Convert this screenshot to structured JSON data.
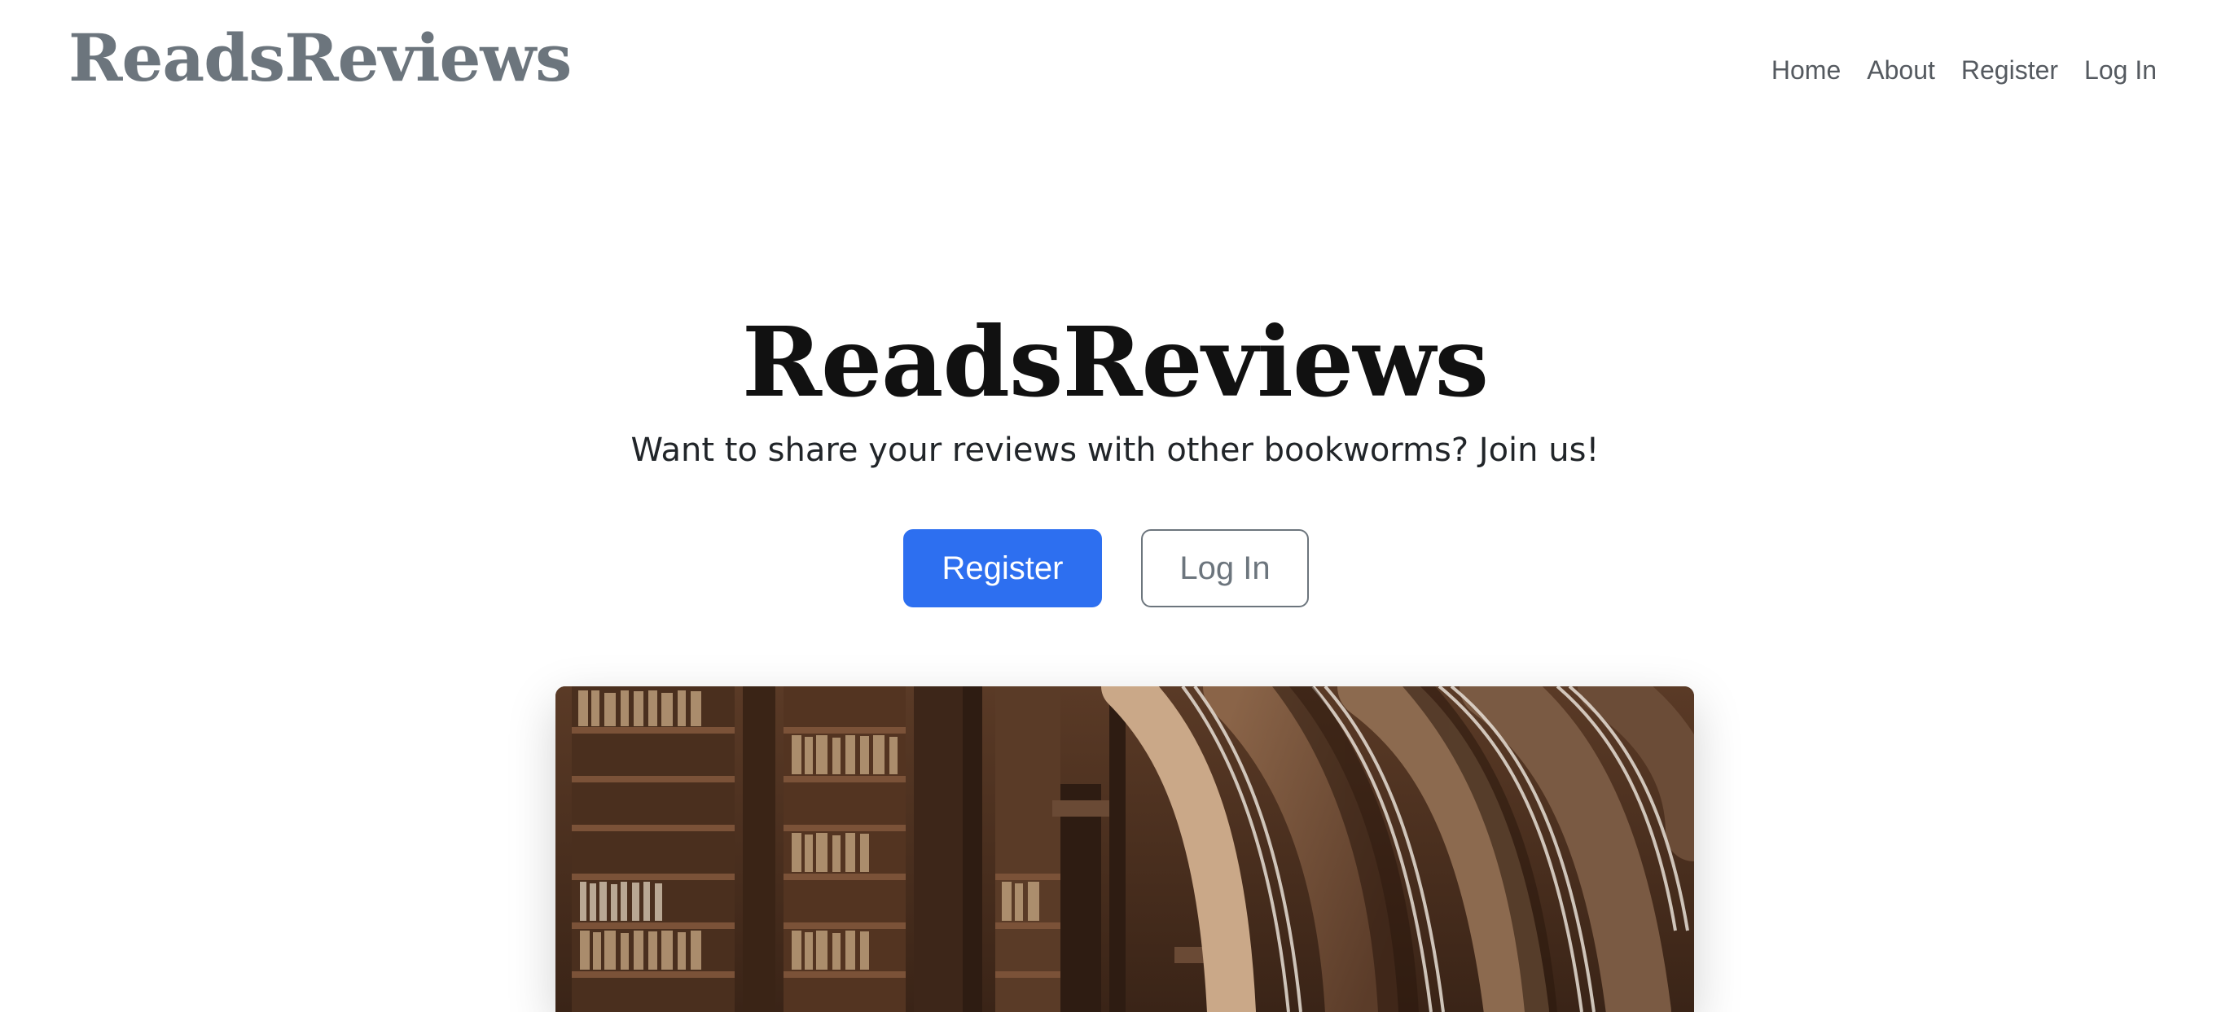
{
  "header": {
    "brand": "ReadsReviews",
    "nav": [
      "Home",
      "About",
      "Register",
      "Log In"
    ]
  },
  "hero": {
    "title": "ReadsReviews",
    "subtitle": "Want to share your reviews with other bookworms? Join us!",
    "primary_button": "Register",
    "secondary_button": "Log In"
  },
  "colors": {
    "brand_gray": "#6c757d",
    "primary_blue": "#2d6ff0",
    "text_dark": "#212529"
  }
}
